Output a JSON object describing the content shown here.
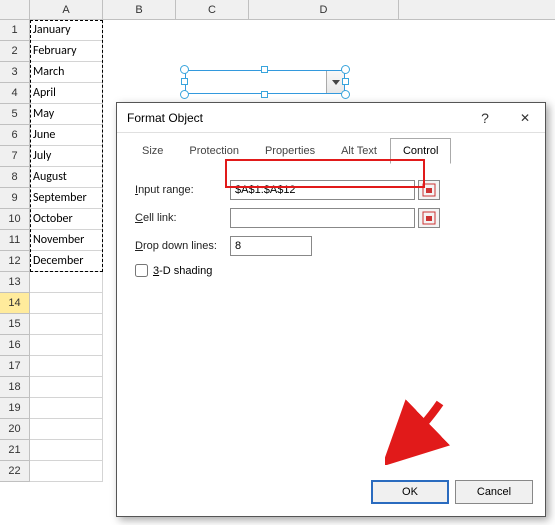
{
  "columns": [
    "A",
    "B",
    "C",
    "D"
  ],
  "rowCount": 22,
  "highlightedRow": 14,
  "cellsA": [
    "January",
    "February",
    "March",
    "April",
    "May",
    "June",
    "July",
    "August",
    "September",
    "October",
    "November",
    "December"
  ],
  "dialog": {
    "title": "Format Object",
    "tabs": [
      "Size",
      "Protection",
      "Properties",
      "Alt Text",
      "Control"
    ],
    "activeTab": "Control",
    "form": {
      "inputRangeLabel": "Input range:",
      "inputRangeValue": "$A$1:$A$12",
      "cellLinkLabel": "Cell link:",
      "cellLinkValue": "",
      "dropDownLabel": "Drop down lines:",
      "dropDownValue": "8",
      "shadingLabel": "3-D shading"
    },
    "buttons": {
      "ok": "OK",
      "cancel": "Cancel"
    }
  }
}
